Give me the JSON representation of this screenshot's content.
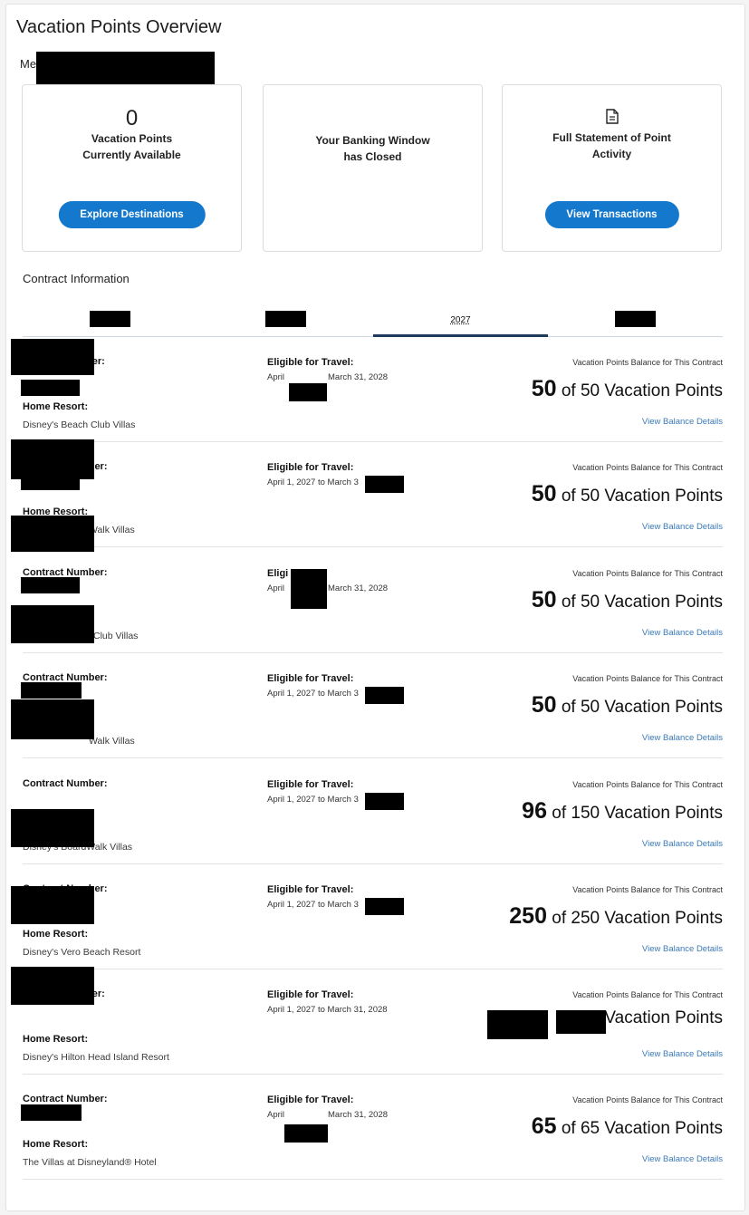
{
  "page": {
    "title": "Vacation Points Overview",
    "member_prefix": "Me"
  },
  "cards": {
    "points": {
      "value": "0",
      "label_line1": "Vacation Points",
      "label_line2": "Currently Available",
      "button": "Explore Destinations"
    },
    "banking": {
      "line1": "Your Banking Window",
      "line2": "has Closed"
    },
    "statement": {
      "icon": "document-icon",
      "line1": "Full Statement of Point",
      "line2": "Activity",
      "button": "View Transactions"
    }
  },
  "contract_section": {
    "label": "Contract Information"
  },
  "tabs": {
    "active": "2027"
  },
  "labels": {
    "contract_number": "Contract Number:",
    "home_resort": "Home Resort:",
    "eligible": "Eligible for Travel:",
    "balance": "Vacation Points Balance for This Contract",
    "details": "View Balance Details",
    "points_suffix": "Vacation Points"
  },
  "contracts": [
    {
      "contract_label": "ber:",
      "home_resort_label": "Home Resort:",
      "home_resort": "Disney's Beach Club Villas",
      "eligible_prefix": "April",
      "eligible_suffix": "March 31, 2028",
      "points": "50",
      "total": "50"
    },
    {
      "contract_label": "Contract Number:",
      "home_resort_label": "Home Resort:",
      "home_resort": "Walk Villas",
      "eligible_prefix": "April 1, 2027 to March 3",
      "eligible_suffix": "",
      "points": "50",
      "total": "50"
    },
    {
      "contract_label": "Contract Number:",
      "home_resort_label": "",
      "home_resort": "Club Villas",
      "eligible_label": "Eligi ravel:",
      "eligible_prefix": "April",
      "eligible_suffix": "March 31, 2028",
      "points": "50",
      "total": "50"
    },
    {
      "contract_label": "Contract Number:",
      "home_resort_label": "",
      "home_resort": "Walk Villas",
      "eligible_prefix": "April 1, 2027 to March 3",
      "eligible_suffix": "",
      "points": "50",
      "total": "50"
    },
    {
      "contract_label": "Contract Number:",
      "home_resort_label": "",
      "home_resort": "Disney's BoardWalk Villas",
      "eligible_prefix": "April 1, 2027 to March 3",
      "eligible_suffix": "",
      "points": "96",
      "total": "150"
    },
    {
      "contract_label": "Contract Number:",
      "home_resort_label": "Home Resort:",
      "home_resort": "Disney's Vero Beach Resort",
      "eligible_prefix": "April 1, 2027 to March 3",
      "eligible_suffix": "",
      "points": "250",
      "total": "250"
    },
    {
      "contract_label": "ber:",
      "home_resort_label": "Home Resort:",
      "home_resort": "Disney's Hilton Head Island Resort",
      "eligible_prefix": "April 1, 2027 to March 31, 2028",
      "eligible_suffix": "",
      "points_text": "Vacation Points"
    },
    {
      "contract_label": "Contract Number:",
      "home_resort_label": "Home Resort:",
      "home_resort": "The Villas at Disneyland® Hotel",
      "eligible_prefix": "April",
      "eligible_suffix": "March 31, 2028",
      "points": "65",
      "total": "65"
    }
  ],
  "colors": {
    "button": "#1478cc",
    "link": "#3b7ab7",
    "tab_active": "#1d3b5c"
  }
}
